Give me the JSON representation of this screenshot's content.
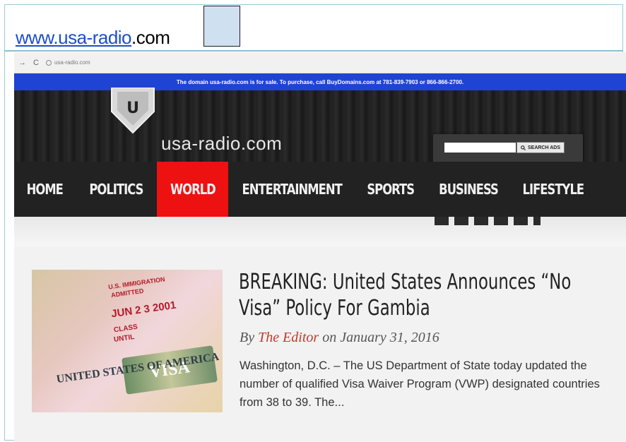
{
  "caption": {
    "link_text": "www.usa-radio",
    "suffix_text": ".com"
  },
  "browser": {
    "back_icon": "→",
    "reload_icon": "C",
    "url": "usa-radio.com"
  },
  "sale_banner": {
    "text": "The domain usa-radio.com is for sale. To purchase, call BuyDomains.com at 781-839-7903 or 866-866-2700."
  },
  "header": {
    "logo_letter": "U",
    "site_name": "usa-radio.com",
    "search_button_label": "SEARCH ADS",
    "search_placeholder": ""
  },
  "nav": {
    "items": [
      {
        "label": "HOME",
        "active": false
      },
      {
        "label": "POLITICS",
        "active": false
      },
      {
        "label": "WORLD",
        "active": true
      },
      {
        "label": "ENTERTAINMENT",
        "active": false
      },
      {
        "label": "SPORTS",
        "active": false
      },
      {
        "label": "BUSINESS",
        "active": false
      },
      {
        "label": "LIFESTYLE",
        "active": false
      }
    ],
    "active_color": "#ee1111"
  },
  "article": {
    "headline": "BREAKING: United States Announces “No Visa” Policy For Gambia",
    "by": "By",
    "author": "The Editor",
    "on": "on",
    "date": "January 31, 2016",
    "excerpt": "Washington, D.C. – The US Department of State today updated the number of qualified Visa Waiver Program (VWP) designated countries from 38 to 39. The...",
    "image": {
      "stamp_line1": "U.S. IMMIGRATION",
      "stamp_line2": "ADMITTED",
      "stamp_date": "JUN 2 3 2001",
      "stamp_class": "CLASS",
      "stamp_until": "UNTIL",
      "visa_text": "VISA",
      "country_text": "UNITED STATES OF AMERICA"
    }
  },
  "colors": {
    "sale_bar": "#1f43d2",
    "nav_bg": "#222222",
    "author": "#c03a2b",
    "caption_link": "#1a50c8"
  }
}
